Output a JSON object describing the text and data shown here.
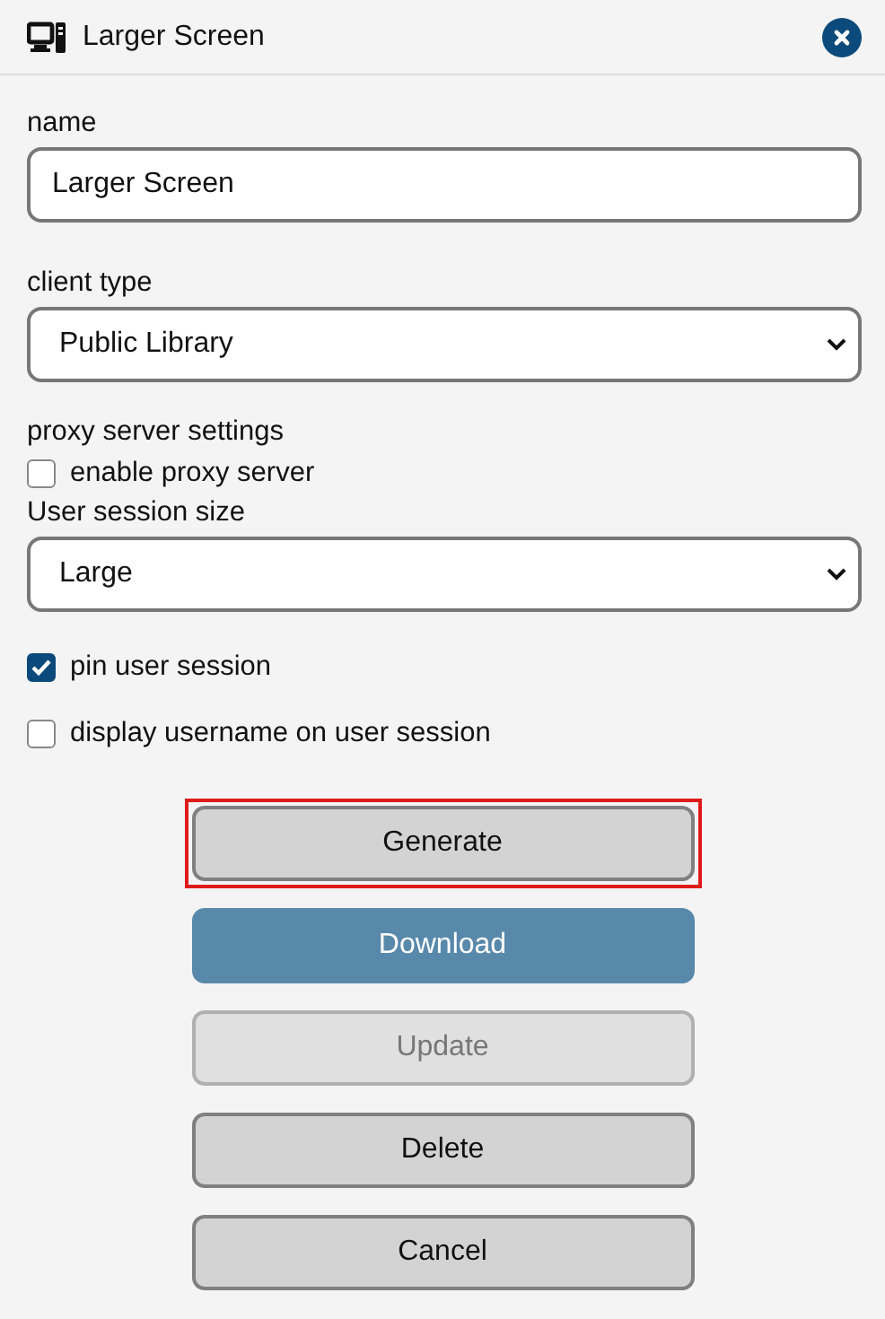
{
  "dialog": {
    "title": "Larger Screen"
  },
  "fields": [
    {
      "kind": "text",
      "label": "name",
      "value": "Larger Screen"
    },
    {
      "kind": "select",
      "label": "client type",
      "value": "Public Library"
    },
    {
      "kind": "heading",
      "label": "proxy server settings"
    },
    {
      "kind": "checkbox",
      "label": "enable proxy server",
      "checked": false
    },
    {
      "kind": "select",
      "label": "User session size",
      "value": "Large"
    },
    {
      "kind": "checkbox",
      "label": "pin user session",
      "checked": true
    },
    {
      "kind": "checkbox",
      "label": "display username on user session",
      "checked": false
    }
  ],
  "buttons": [
    {
      "label": "Generate",
      "kind": "default",
      "disabled": false,
      "focused": true
    },
    {
      "label": "Download",
      "kind": "primary",
      "disabled": false,
      "focused": false
    },
    {
      "label": "Update",
      "kind": "default",
      "disabled": true,
      "focused": false
    },
    {
      "label": "Delete",
      "kind": "default",
      "disabled": false,
      "focused": false
    },
    {
      "label": "Cancel",
      "kind": "default",
      "disabled": false,
      "focused": false
    }
  ]
}
